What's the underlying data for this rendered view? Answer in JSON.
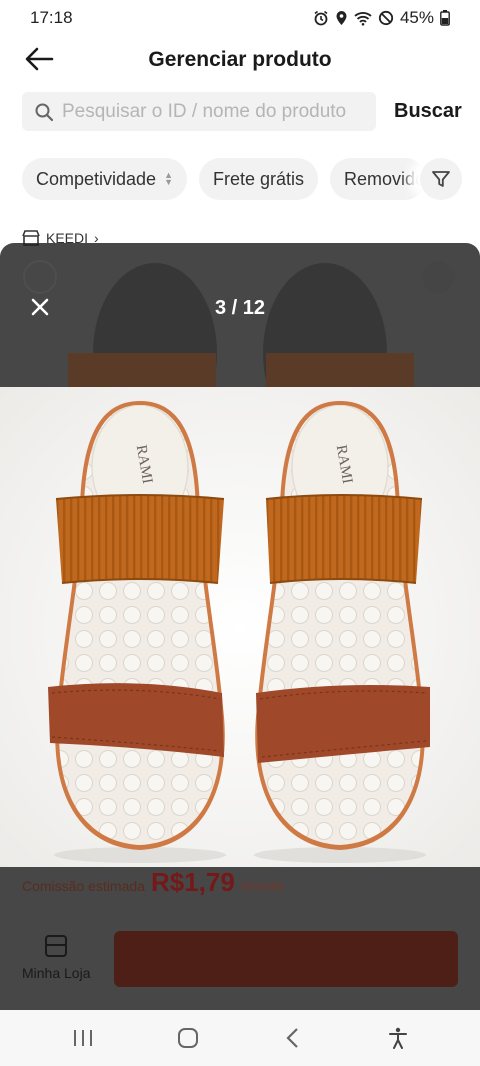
{
  "status_bar": {
    "time": "17:18",
    "battery": "45%"
  },
  "header": {
    "title": "Gerenciar produto"
  },
  "search": {
    "placeholder": "Pesquisar o ID / nome do produto",
    "button_label": "Buscar"
  },
  "filters": {
    "chips": [
      "Competividade",
      "Frete grátis",
      "Removido"
    ]
  },
  "shop": {
    "name": "KEEDI"
  },
  "viewer": {
    "counter": "3 / 12"
  },
  "background": {
    "commission_label": "Comissão estimada",
    "commission_value": "R$1,79",
    "commission_rate": "6%OM",
    "tab_label": "Minha Loja"
  },
  "colors": {
    "accent": "#c2410c",
    "sandal_leather": "#a0492a",
    "sandal_strap": "#c0681e",
    "sole": "#f1ede6"
  }
}
